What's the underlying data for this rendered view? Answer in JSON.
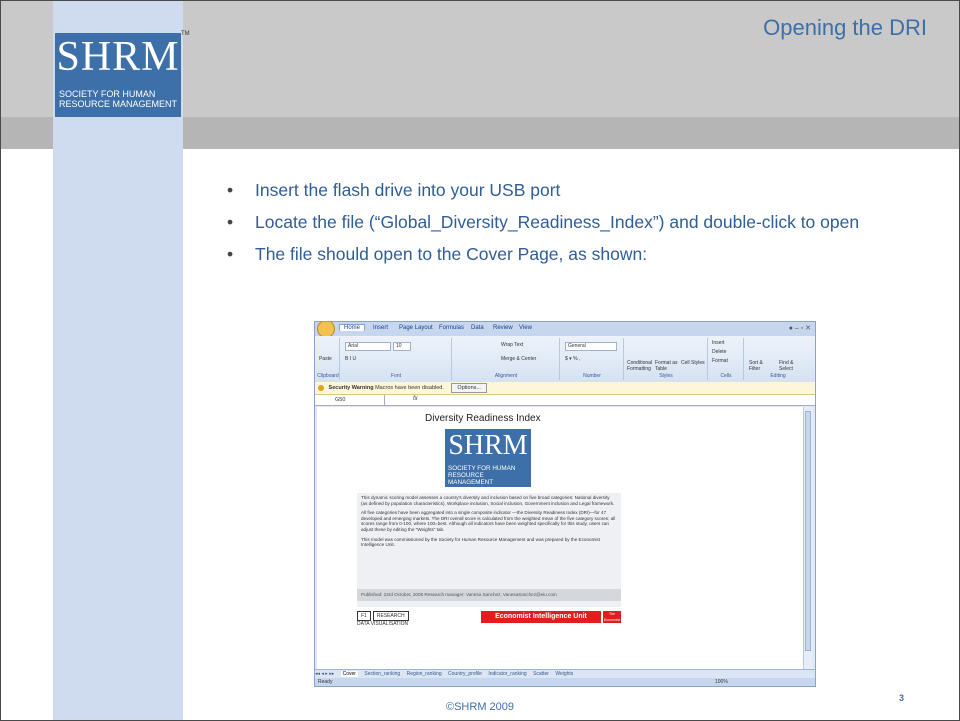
{
  "header": {
    "logo_letters": "SHRM",
    "logo_tm": "TM",
    "logo_subtitle_line1": "SOCIETY FOR HUMAN",
    "logo_subtitle_line2": "RESOURCE MANAGEMENT",
    "title": "Opening the DRI"
  },
  "bullets": [
    "Insert the flash drive into your USB port",
    "Locate the file (“Global_Diversity_Readiness_Index”) and double-click to open",
    "The file should open to the Cover Page, as shown:"
  ],
  "bullet_glyph": "•",
  "footer": {
    "copyright": "©SHRM 2009",
    "page_number": "3"
  },
  "excel": {
    "tabs": [
      "Home",
      "Insert",
      "Page Layout",
      "Formulas",
      "Data",
      "Review",
      "View"
    ],
    "ribbon": {
      "paste_label": "Paste",
      "clipboard_label": "Clipboard",
      "font_name": "Arial",
      "font_size": "10",
      "font_label": "Font",
      "wrap_text": "Wrap Text",
      "merge_center": "Merge & Center",
      "alignment_label": "Alignment",
      "number_format": "General",
      "number_label": "Number",
      "styles_buttons": [
        "Conditional Formatting",
        "Format as Table",
        "Cell Styles"
      ],
      "styles_label": "Styles",
      "cells_buttons": [
        "Insert",
        "Delete",
        "Format"
      ],
      "cells_label": "Cells",
      "editing_buttons": [
        "Sort & Filter",
        "Find & Select"
      ],
      "editing_label": "Editing"
    },
    "security_warning": "Security Warning",
    "security_message": "Macros have been disabled.",
    "options_button": "Options...",
    "name_box": "G50",
    "fx_label": "fx",
    "sheet_title": "Diversity Readiness Index",
    "description": [
      "This dynamic scoring model assesses a country's diversity and inclusion based on five broad categories: National diversity (as defined by population characteristics), Workplace inclusion, Social inclusion, Government inclusion and Legal framework.",
      "All five categories have been aggregated into a single composite indicator —the Diversity Readiness Index (DRI)—for 47 developed and emerging markets. The DRI overall score is calculated from the weighted mean of the five category scores; all scores range from 0-100, where 100=best. Although all indicators have been weighted specifically for this study, users can adjust these by editing the \"Weights\" tab.",
      "This model was commissioned by the Society for Human Resource Management and was prepared by the Economist Intelligence Unit."
    ],
    "published": "Published: 23rd October, 2008        Research manager: Vanesa Sanchez, VanesaSanchez@eiu.com",
    "f1_label": "F1",
    "research_label": "RESEARCH",
    "data_vis_label": "DATA VISUALISATION",
    "eiu_label": "Economist Intelligence Unit",
    "economist_label": "The Economist",
    "sheet_tabs": [
      "Cover",
      "Section_ranking",
      "Region_ranking",
      "Country_profile",
      "Indicator_ranking",
      "Scatter",
      "Weights"
    ],
    "status": "Ready",
    "zoom": "100%"
  }
}
